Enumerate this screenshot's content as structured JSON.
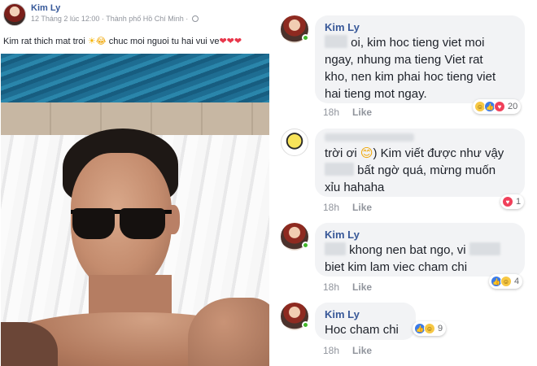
{
  "post": {
    "author": "Kim Ly",
    "meta": "12 Tháng 2 lúc 12:00 · Thành phố Hồ Chí Minh ·",
    "text_before": "Kim rat thich mat troi",
    "text_after": "chuc moi nguoi tu hai vui ve",
    "emojis": {
      "sun": "☀",
      "laugh": "😂",
      "hearts": "❤❤❤"
    }
  },
  "comments": [
    {
      "author": "Kim Ly",
      "lines": [
        "oi, kim hoc tieng viet moi",
        "ngay, nhung ma tieng Viet rat",
        "kho, nen kim phai hoc tieng viet",
        "hai tieng mot ngay."
      ],
      "time": "18h",
      "like": "Like",
      "reactions": [
        "haha",
        "like",
        "love"
      ],
      "reaction_count": "20"
    },
    {
      "author": "",
      "lines": [
        "trời ơi",
        "Kim viết được như vậy",
        "bất ngờ quá, mừng muốn",
        "xỉu hahaha"
      ],
      "emoji": "😊",
      "time": "18h",
      "like": "Like",
      "reactions": [
        "love"
      ],
      "reaction_count": "1"
    },
    {
      "author": "Kim Ly",
      "lines": [
        "khong nen bat ngo, vi",
        "biet kim lam viec cham chi"
      ],
      "time": "18h",
      "like": "Like",
      "reactions": [
        "like",
        "haha"
      ],
      "reaction_count": "4"
    },
    {
      "author": "Kim Ly",
      "lines": [
        "Hoc cham chi"
      ],
      "time": "18h",
      "like": "Like",
      "reactions": [
        "like",
        "haha"
      ],
      "reaction_count": "9"
    }
  ],
  "colors": {
    "link": "#385898",
    "bubble": "#f2f3f5",
    "online": "#42b72a",
    "like": "#3b7be8",
    "love": "#f0405a",
    "haha": "#f7c844"
  }
}
